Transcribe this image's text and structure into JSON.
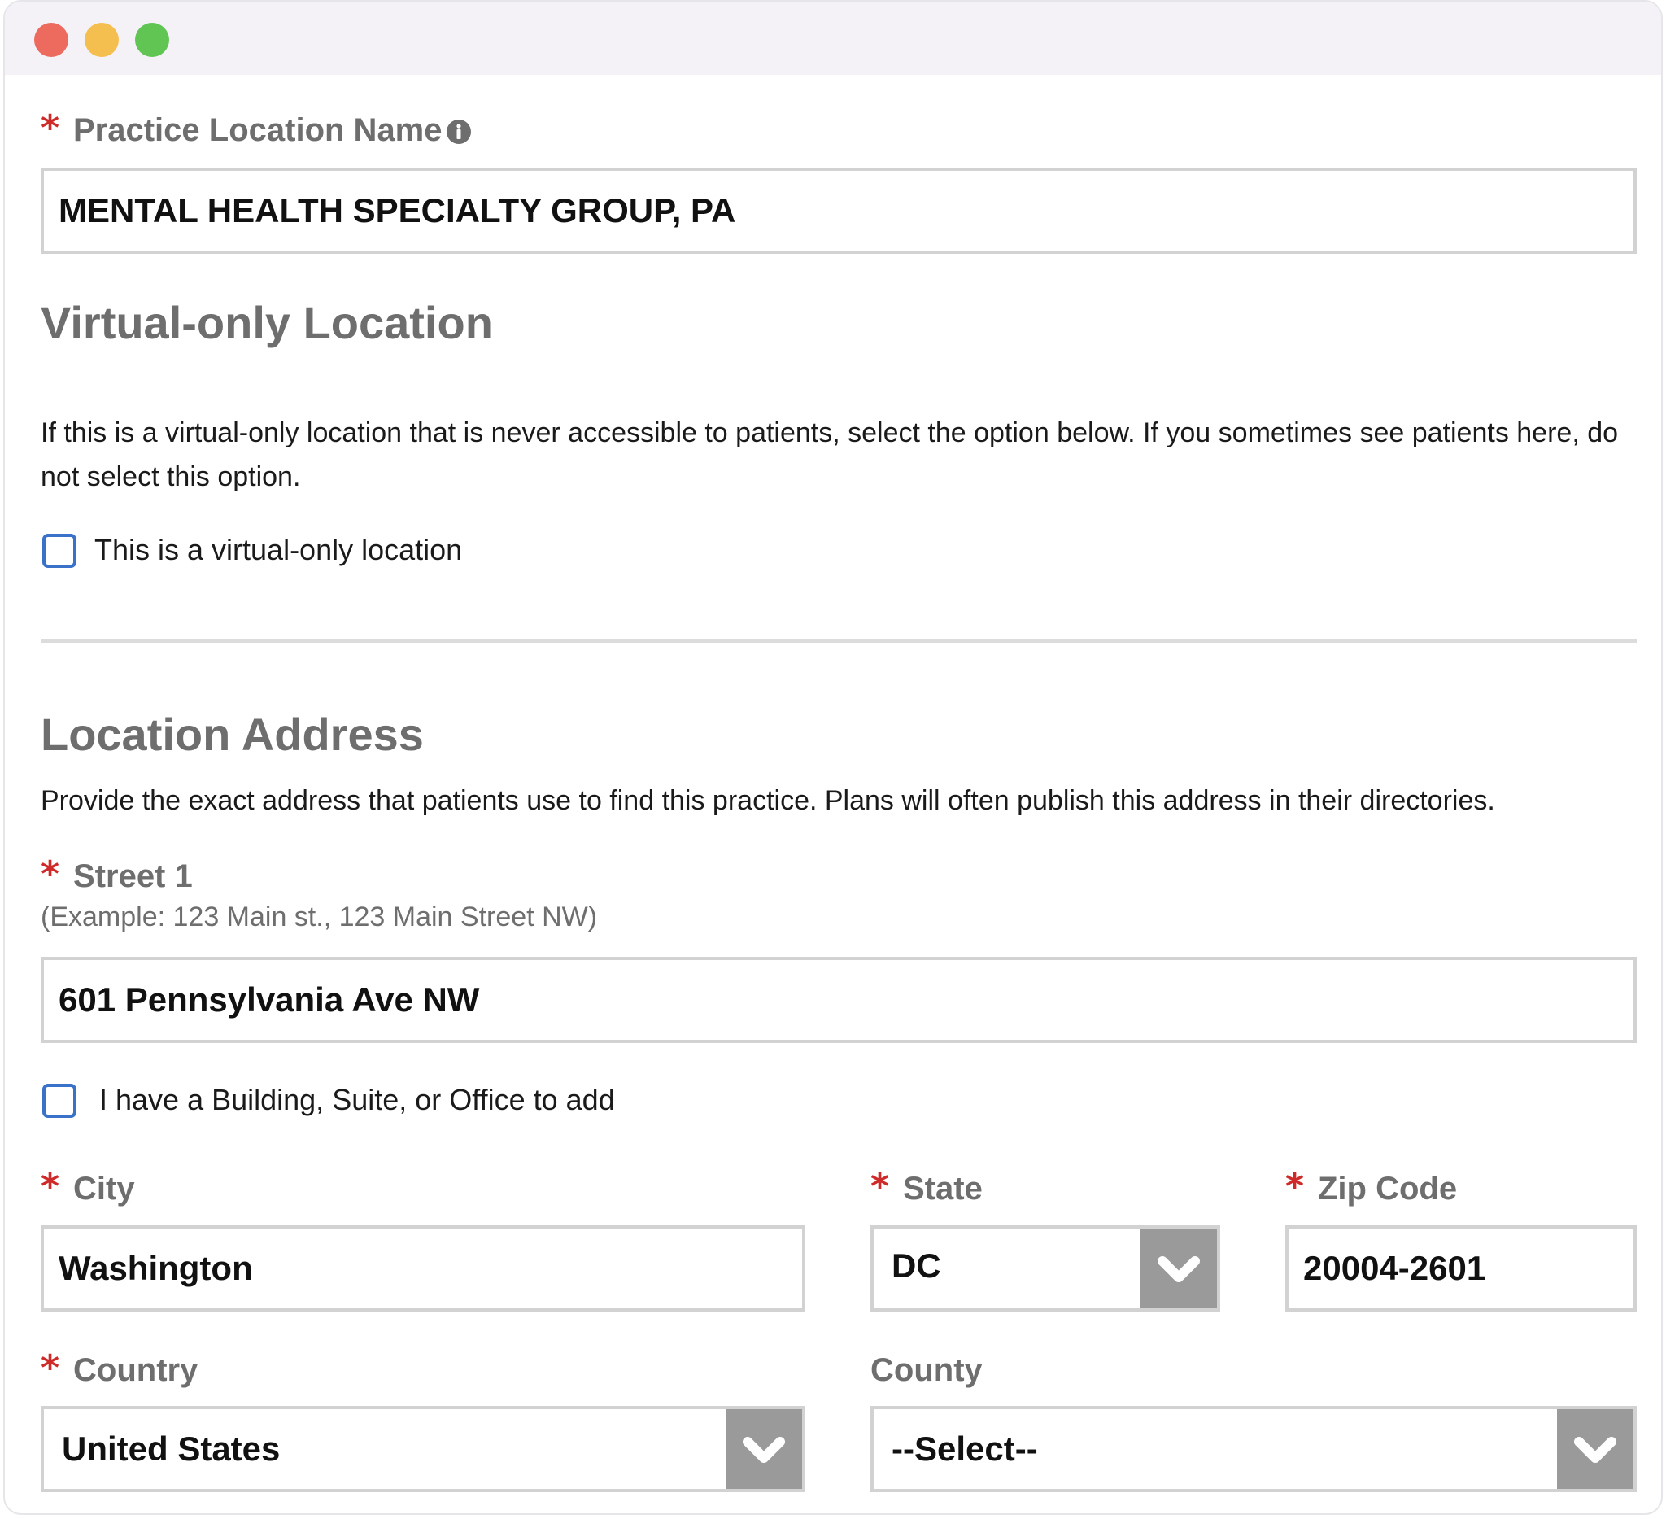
{
  "form": {
    "required_mark": "*",
    "practice_location": {
      "label": "Practice Location Name",
      "value": "MENTAL HEALTH SPECIALTY GROUP, PA"
    },
    "virtual": {
      "heading": "Virtual-only Location",
      "description": "If this is a virtual-only location that is never accessible to patients, select the option below. If you sometimes see patients here, do not select this option.",
      "checkbox_label": "This is a virtual-only location",
      "checked": false
    },
    "address": {
      "heading": "Location Address",
      "description": "Provide the exact address that patients use to find this practice. Plans will often publish this address in their directories.",
      "street1_label": "Street 1",
      "street1_hint": "(Example: 123 Main st., 123 Main Street NW)",
      "street1_value": "601 Pennsylvania Ave NW",
      "suite_checkbox_label": "I have a Building, Suite, or Office to add",
      "suite_checked": false,
      "city_label": "City",
      "city_value": "Washington",
      "state_label": "State",
      "state_value": "DC",
      "zip_label": "Zip Code",
      "zip_value": "20004-2601",
      "country_label": "Country",
      "country_value": "United States",
      "county_label": "County",
      "county_value": "--Select--"
    }
  },
  "colors": {
    "required": "#cf2a2a",
    "label": "#6e6e6e",
    "checkbox_border": "#3a72c9",
    "select_button": "#9a9a9a"
  }
}
